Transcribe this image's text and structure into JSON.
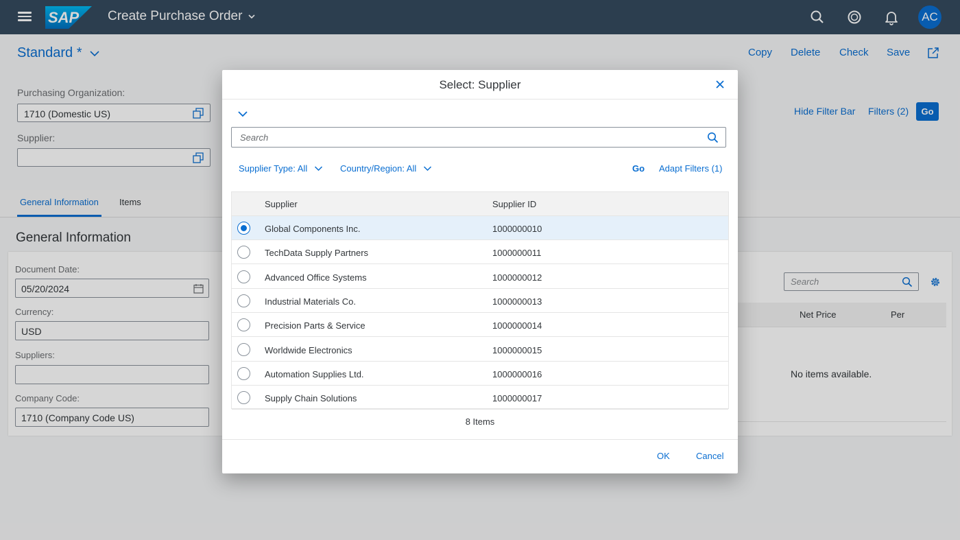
{
  "shell": {
    "logo_text": "SAP",
    "app_title": "Create Purchase Order",
    "avatar_initials": "AC",
    "icons": [
      "search-icon",
      "help-icon",
      "bell-icon"
    ]
  },
  "header": {
    "variant": "Standard *",
    "actions": [
      "Copy",
      "Delete",
      "Check",
      "Save"
    ]
  },
  "filter_bar": {
    "purchasing_org_label": "Purchasing Organization:",
    "purchasing_org_value": "1710 (Domestic US)",
    "supplier_label": "Supplier:",
    "supplier_value": "",
    "hide_filter_bar": "Hide Filter Bar",
    "filters": "Filters (2)",
    "go": "Go"
  },
  "tabs": [
    "General Information",
    "Items"
  ],
  "general": {
    "section_title": "General Information",
    "document_date_label": "Document Date:",
    "document_date_value": "05/20/2024",
    "currency_label": "Currency:",
    "currency_value": "USD",
    "suppliers_label": "Suppliers:",
    "suppliers_value": "",
    "company_code_label": "Company Code:",
    "company_code_value": "1710 (Company Code US)"
  },
  "items_table": {
    "search_placeholder": "Search",
    "columns": [
      "Net Price",
      "Per"
    ],
    "empty_text": "No items available."
  },
  "dialog": {
    "title": "Select: Supplier",
    "search_placeholder": "Search",
    "filter_supplier_type": "Supplier Type: All",
    "filter_country": "Country/Region: All",
    "go": "Go",
    "adapt_filters": "Adapt Filters (1)",
    "columns": [
      "Supplier",
      "Supplier ID"
    ],
    "rows": [
      {
        "name": "Global Components Inc.",
        "id": "1000000010",
        "selected": true
      },
      {
        "name": "TechData Supply Partners",
        "id": "1000000011",
        "selected": false
      },
      {
        "name": "Advanced Office Systems",
        "id": "1000000012",
        "selected": false
      },
      {
        "name": "Industrial Materials Co.",
        "id": "1000000013",
        "selected": false
      },
      {
        "name": "Precision Parts & Service",
        "id": "1000000014",
        "selected": false
      },
      {
        "name": "Worldwide Electronics",
        "id": "1000000015",
        "selected": false
      },
      {
        "name": "Automation Supplies Ltd.",
        "id": "1000000016",
        "selected": false
      },
      {
        "name": "Supply Chain Solutions",
        "id": "1000000017",
        "selected": false
      }
    ],
    "count_text": "8 Items",
    "ok": "OK",
    "cancel": "Cancel"
  },
  "colors": {
    "shell_bg": "#354a5f",
    "accent": "#0a6ed1",
    "selected_row": "#e5f0fa"
  }
}
